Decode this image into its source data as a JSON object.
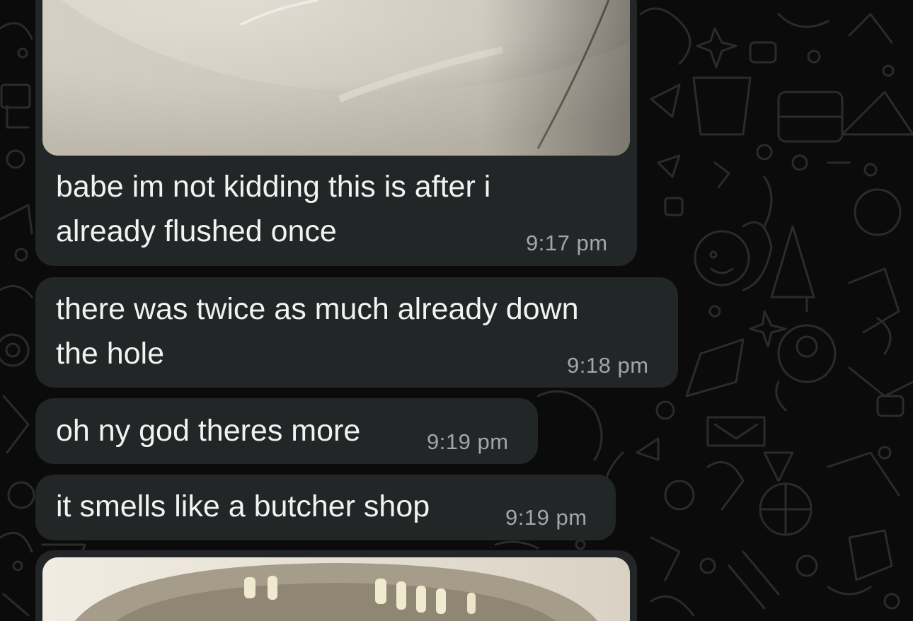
{
  "app": {
    "screen": "chat-conversation",
    "theme": "dark",
    "colors": {
      "background": "#0b0b0b",
      "bubble": "#232626",
      "message_text": "#f2f2f2",
      "timestamp_text": "#a3a6a6"
    }
  },
  "messages": [
    {
      "type": "image",
      "description_hidden": true
    },
    {
      "type": "text",
      "line1": "babe im not kidding this is after i",
      "line2": "already flushed once",
      "time": "9:17 pm"
    },
    {
      "type": "text",
      "line1": "there was twice as much already down",
      "line2": "the hole",
      "time": "9:18 pm"
    },
    {
      "type": "text",
      "line1": "oh ny god theres more",
      "time": "9:19 pm"
    },
    {
      "type": "text",
      "line1": "it smells like a butcher shop",
      "time": "9:19 pm"
    },
    {
      "type": "image",
      "description_hidden": true
    }
  ]
}
